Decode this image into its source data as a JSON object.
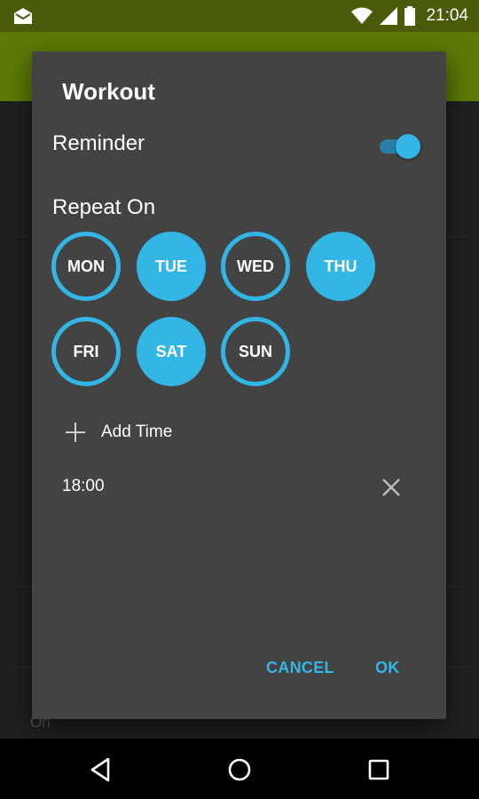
{
  "status_bar": {
    "time": "21:04",
    "icons": [
      "mail-icon",
      "wifi-icon",
      "cell-signal-icon",
      "battery-icon"
    ]
  },
  "dialog": {
    "title": "Workout",
    "reminder": {
      "label": "Reminder",
      "enabled": true
    },
    "repeat": {
      "label": "Repeat On",
      "days": [
        {
          "label": "MON",
          "selected": false
        },
        {
          "label": "TUE",
          "selected": true
        },
        {
          "label": "WED",
          "selected": false
        },
        {
          "label": "THU",
          "selected": true
        },
        {
          "label": "FRI",
          "selected": false
        },
        {
          "label": "SAT",
          "selected": true
        },
        {
          "label": "SUN",
          "selected": false
        }
      ]
    },
    "add_time_label": "Add Time",
    "times": [
      "18:00"
    ],
    "cancel_label": "CANCEL",
    "ok_label": "OK"
  },
  "background": {
    "partial_text": "On"
  },
  "colors": {
    "accent": "#33b5e5",
    "appbar": "#5d7a06",
    "statusbar": "#4a5b0c",
    "dialog_bg": "#434343"
  }
}
